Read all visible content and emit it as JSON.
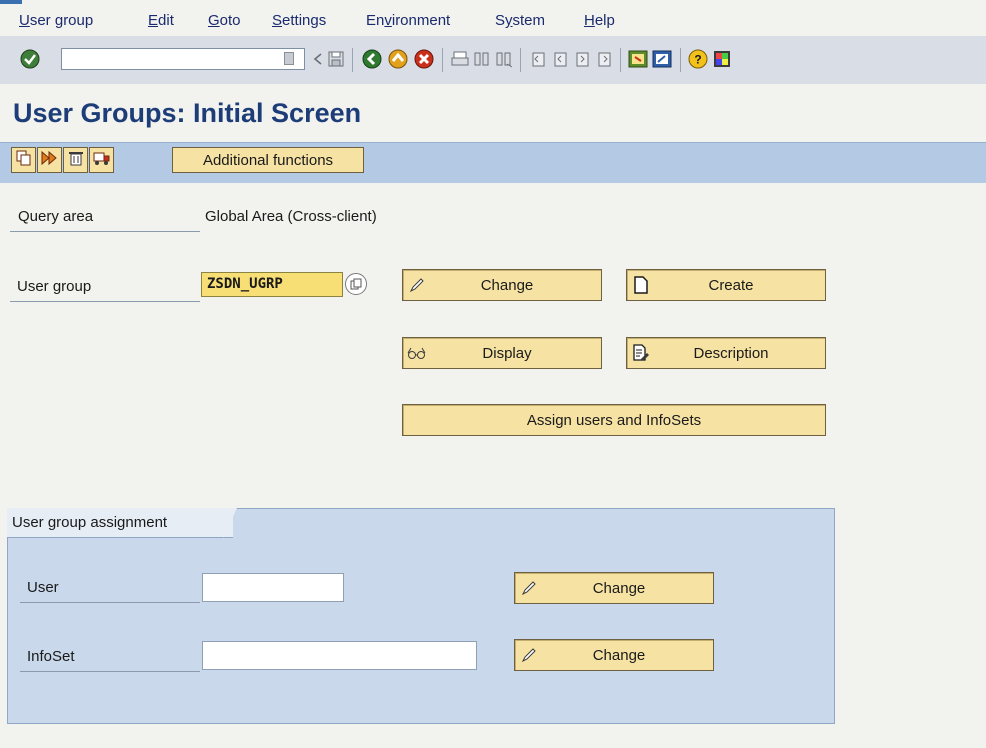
{
  "menu": {
    "items": [
      {
        "label": "User group",
        "u": "U",
        "rest": "ser group"
      },
      {
        "label": "Edit",
        "u": "E",
        "rest": "dit"
      },
      {
        "label": "Goto",
        "u": "G",
        "rest": "oto"
      },
      {
        "label": "Settings",
        "u": "S",
        "rest": "ettings"
      },
      {
        "label": "Environment",
        "pre": "En",
        "u": "v",
        "rest": "ironment"
      },
      {
        "label": "System",
        "pre": "S",
        "u": "y",
        "rest": "stem"
      },
      {
        "label": "Help",
        "u": "H",
        "rest": "elp"
      }
    ]
  },
  "toolbar": {
    "command_field_value": "",
    "icons": [
      "enter-icon",
      "back-nav-icon",
      "save-icon",
      "back-icon",
      "exit-icon",
      "cancel-icon",
      "print-icon",
      "find-icon",
      "find-next-icon",
      "first-page-icon",
      "previous-page-icon",
      "next-page-icon",
      "last-page-icon",
      "create-session-icon",
      "shortcut-icon",
      "help-icon",
      "layout-menu-icon"
    ]
  },
  "page": {
    "title": "User Groups: Initial Screen"
  },
  "app_toolbar": {
    "icons": [
      "copy-icon",
      "execute-icon",
      "delete-icon",
      "transport-icon"
    ],
    "additional_functions_label": "Additional functions"
  },
  "form": {
    "query_area_label": "Query area",
    "query_area_value": "Global Area (Cross-client)",
    "user_group_label": "User group",
    "user_group_value": "ZSDN_UGRP",
    "buttons": {
      "change": "Change",
      "create": "Create",
      "display": "Display",
      "description": "Description",
      "assign": "Assign users and InfoSets"
    }
  },
  "assignment": {
    "title": "User group assignment",
    "user_label": "User",
    "user_value": "",
    "infoset_label": "InfoSet",
    "infoset_value": "",
    "change_user": "Change",
    "change_infoset": "Change"
  },
  "colors": {
    "title": "#1d3d78",
    "menu_text": "#1a2a6e",
    "button_fill": "#f6e3a4",
    "input_required": "#f8df75",
    "app_toolbar": "#b4c9e3",
    "frame": "#c9d9eb"
  }
}
